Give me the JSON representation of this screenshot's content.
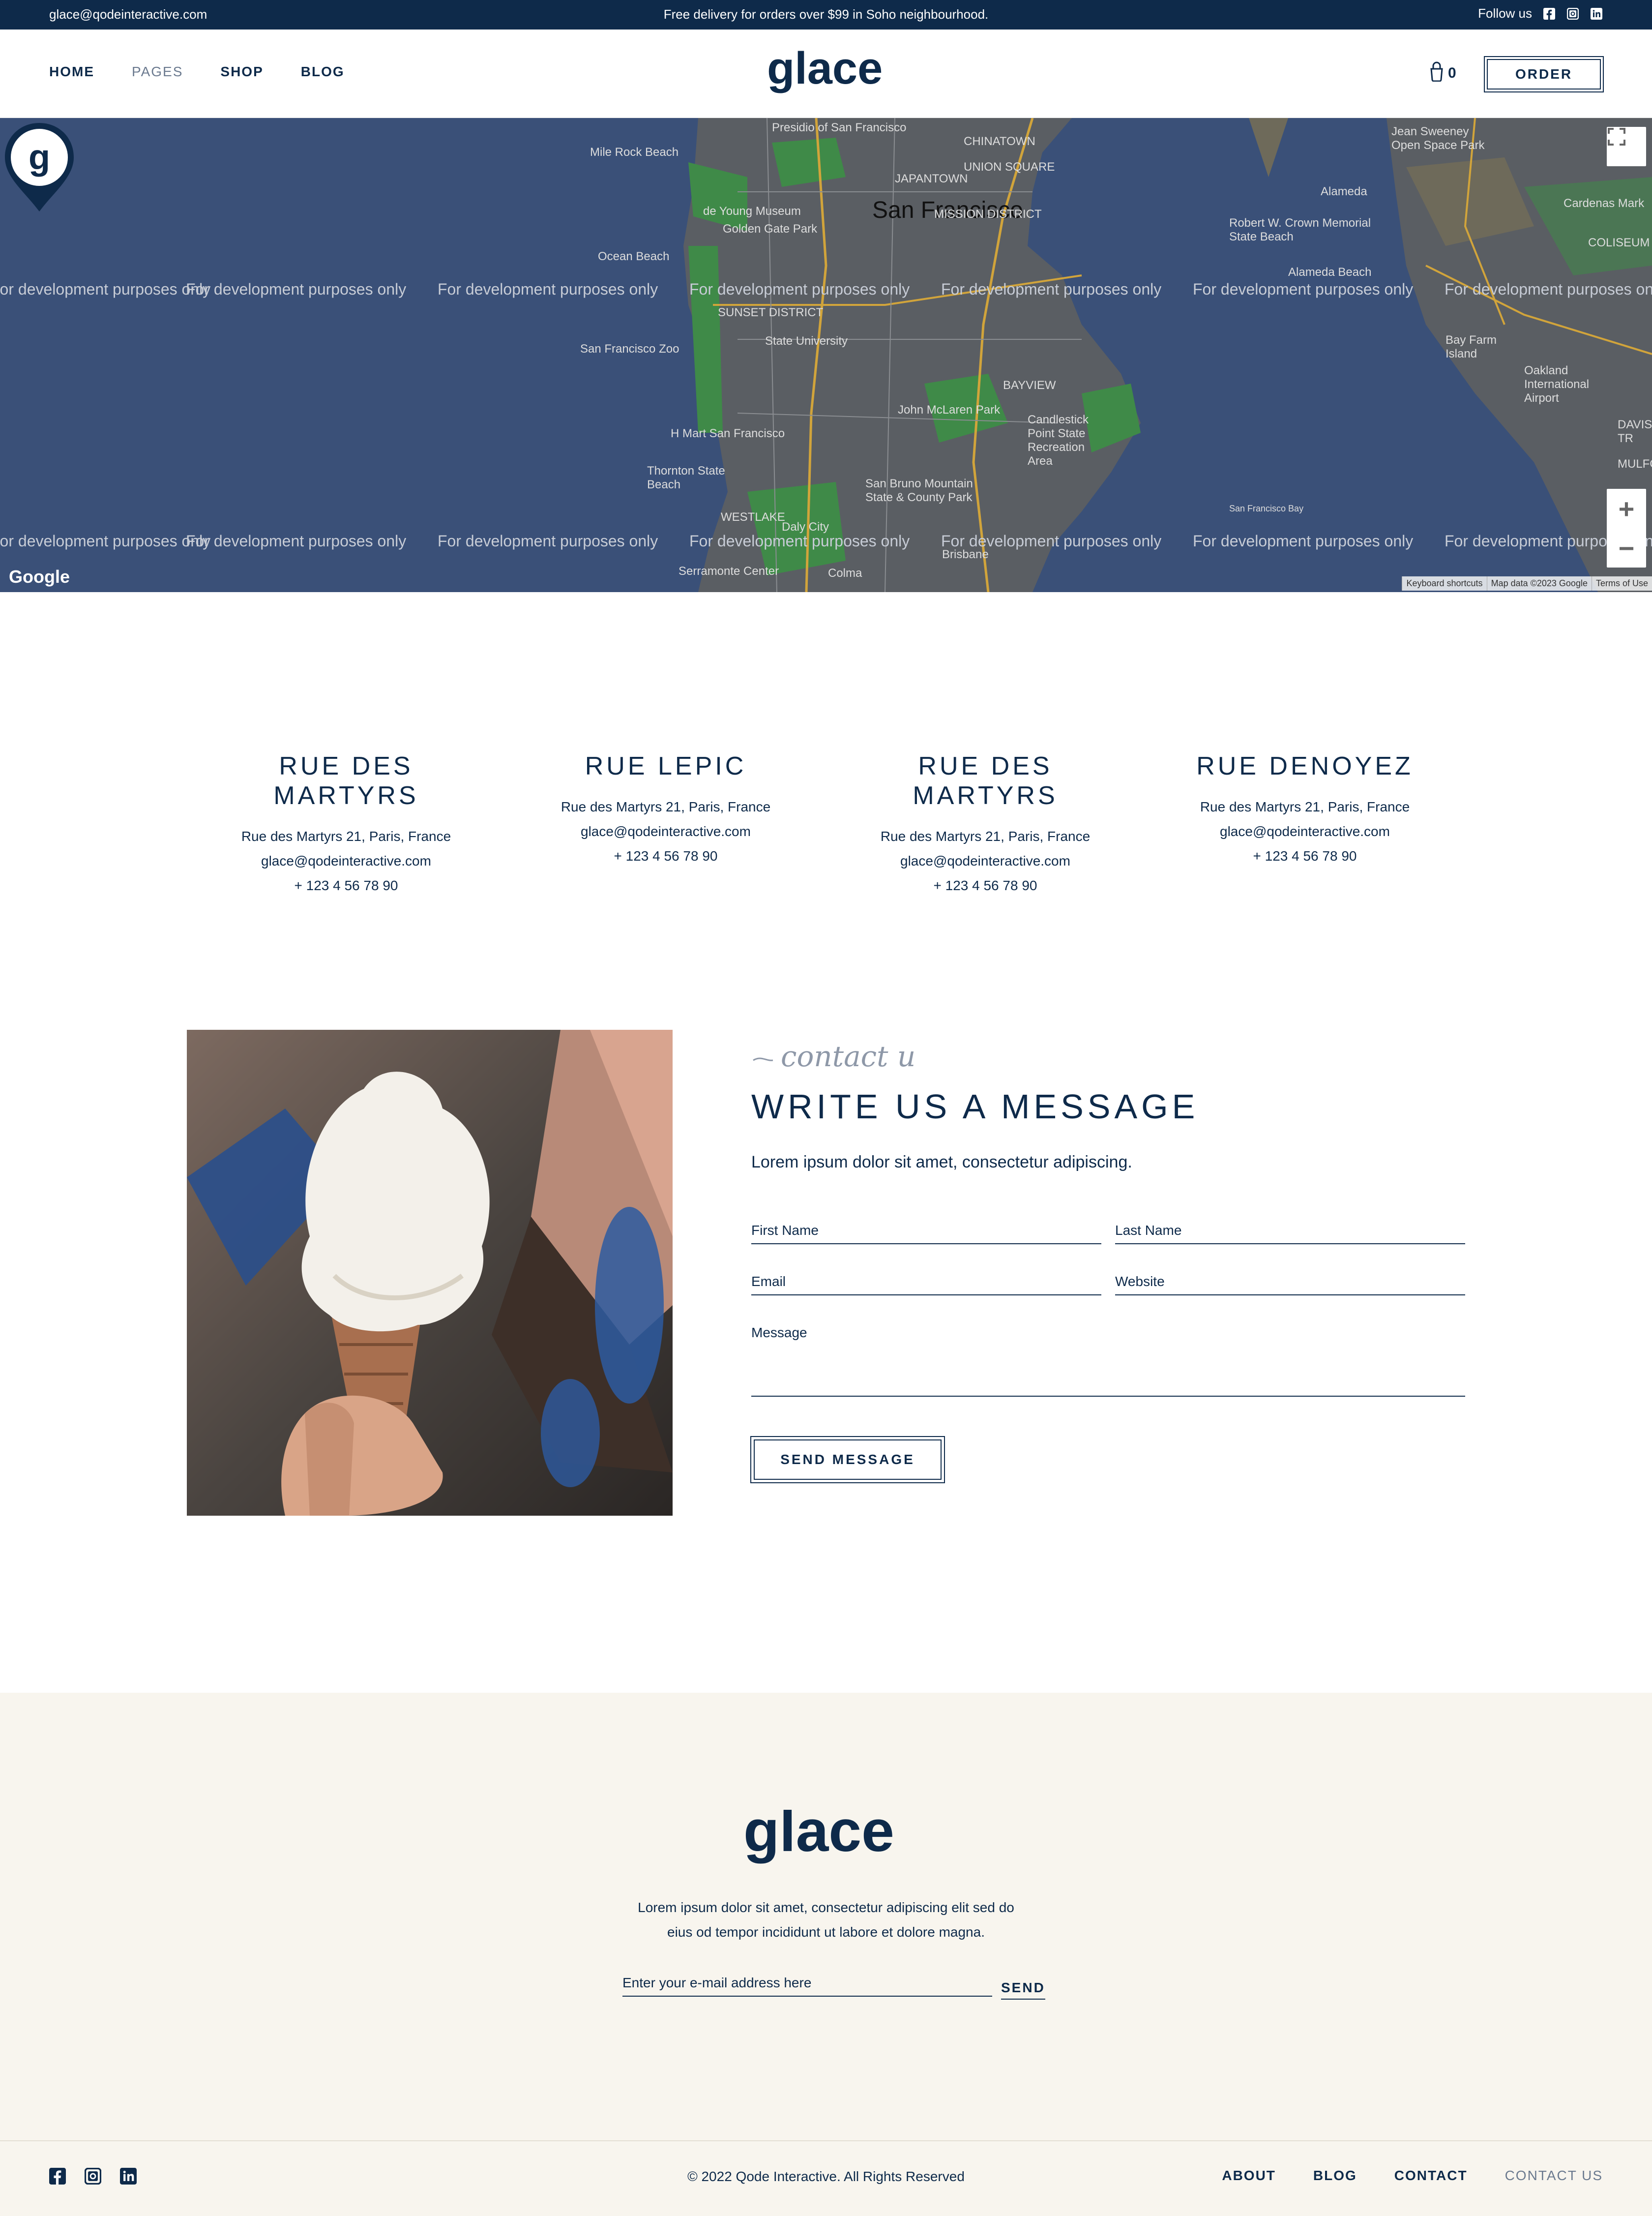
{
  "topbar": {
    "email": "glace@qodeinteractive.com",
    "promo": "Free delivery for orders over $99 in Soho neighbourhood.",
    "follow": "Follow us",
    "icons": [
      "facebook-icon",
      "instagram-icon",
      "linkedin-icon"
    ]
  },
  "header": {
    "nav": [
      "HOME",
      "PAGES",
      "SHOP",
      "BLOG"
    ],
    "logo": "glace",
    "cart_count": "0",
    "order": "ORDER"
  },
  "map": {
    "watermark": "For development purposes only",
    "city": "San Francisco",
    "places": [
      "Presidio of San Francisco",
      "CHINATOWN",
      "UNION SQUARE",
      "JAPANTOWN",
      "Mile Rock Beach",
      "de Young Museum",
      "Golden Gate Park",
      "Ocean Beach",
      "MISSION DISTRICT",
      "SUNSET DISTRICT",
      "San Francisco Zoo",
      "State University",
      "BAYVIEW",
      "John McLaren Park",
      "Candlestick Point State Recreation Area",
      "H Mart San Francisco",
      "Thornton State Beach",
      "San Bruno Mountain State & County Park",
      "Daly City",
      "WESTLAKE",
      "Brisbane",
      "Serramonte Center",
      "Colma",
      "Jean Sweeney Open Space Park",
      "Alameda",
      "Robert W. Crown Memorial State Beach",
      "Cardenas Mark",
      "Alameda Beach",
      "Bay Farm Island",
      "Oakland International Airport",
      "San Francisco Bay",
      "DAVIS TR",
      "COLISEUM",
      "MULFORD"
    ],
    "brand": "Google",
    "attribution": [
      "Keyboard shortcuts",
      "Map data ©2023 Google",
      "Terms of Use"
    ],
    "zoom_in": "+",
    "zoom_out": "−"
  },
  "locations": [
    {
      "title": "RUE DES MARTYRS",
      "address": "Rue des Martyrs 21, Paris, France",
      "email": "glace@qodeinteractive.com",
      "phone": "+ 123 4 56 78 90"
    },
    {
      "title": "RUE LEPIC",
      "address": "Rue des Martyrs 21, Paris, France",
      "email": "glace@qodeinteractive.com",
      "phone": "+ 123 4 56 78 90"
    },
    {
      "title": "RUE DES MARTYRS",
      "address": "Rue des Martyrs 21, Paris, France",
      "email": "glace@qodeinteractive.com",
      "phone": "+ 123 4 56 78 90"
    },
    {
      "title": "RUE DENOYEZ",
      "address": "Rue des Martyrs 21, Paris, France",
      "email": "glace@qodeinteractive.com",
      "phone": "+ 123 4 56 78 90"
    }
  ],
  "contact": {
    "script": "contact us",
    "title": "WRITE US A MESSAGE",
    "subtitle": "Lorem ipsum dolor sit amet, consectetur adipiscing.",
    "first_name": "First Name",
    "last_name": "Last Name",
    "email": "Email",
    "website": "Website",
    "message": "Message",
    "send": "SEND MESSAGE"
  },
  "footer": {
    "logo": "glace",
    "text_line1": "Lorem ipsum dolor sit amet, consectetur adipiscing elit sed do",
    "text_line2": "eius od tempor incididunt ut labore et dolore magna.",
    "newsletter_placeholder": "Enter your e-mail address here",
    "send": "SEND",
    "copyright": "© 2022 Qode Interactive. All Rights Reserved",
    "links": [
      "ABOUT",
      "BLOG",
      "CONTACT",
      "CONTACT US"
    ]
  },
  "colors": {
    "navy": "#0e2a4a",
    "cream": "#f8f5ee",
    "map": "#3a5078",
    "muted": "#6b7a8f"
  }
}
